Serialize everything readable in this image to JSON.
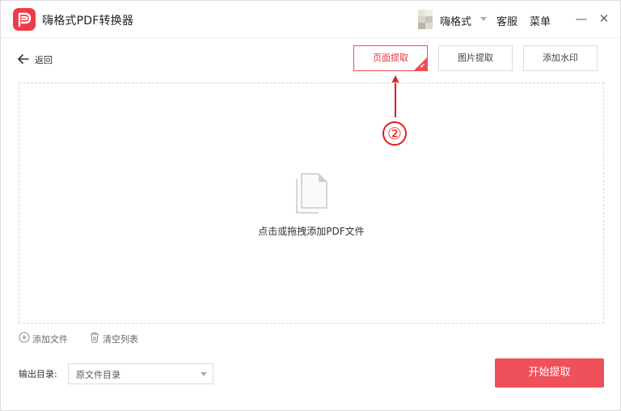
{
  "titlebar": {
    "app_title": "嗨格式PDF转换器",
    "username": "嗨格式",
    "service_label": "客服",
    "menu_label": "菜单",
    "minimize_glyph": "—",
    "close_glyph": "✕"
  },
  "nav": {
    "back_label": "返回"
  },
  "tabs": [
    {
      "label": "页面提取",
      "active": true
    },
    {
      "label": "图片提取",
      "active": false
    },
    {
      "label": "添加水印",
      "active": false
    }
  ],
  "annotation": {
    "number": "②"
  },
  "dropzone": {
    "prompt": "点击或拖拽添加PDF文件",
    "icon": "document-icon"
  },
  "file_actions": {
    "add_label": "添加文件",
    "clear_label": "清空列表"
  },
  "output": {
    "label": "输出目录:",
    "selected": "原文件目录"
  },
  "start_button": {
    "label": "开始提取"
  },
  "colors": {
    "accent": "#f05059",
    "annotation": "#e02020"
  }
}
